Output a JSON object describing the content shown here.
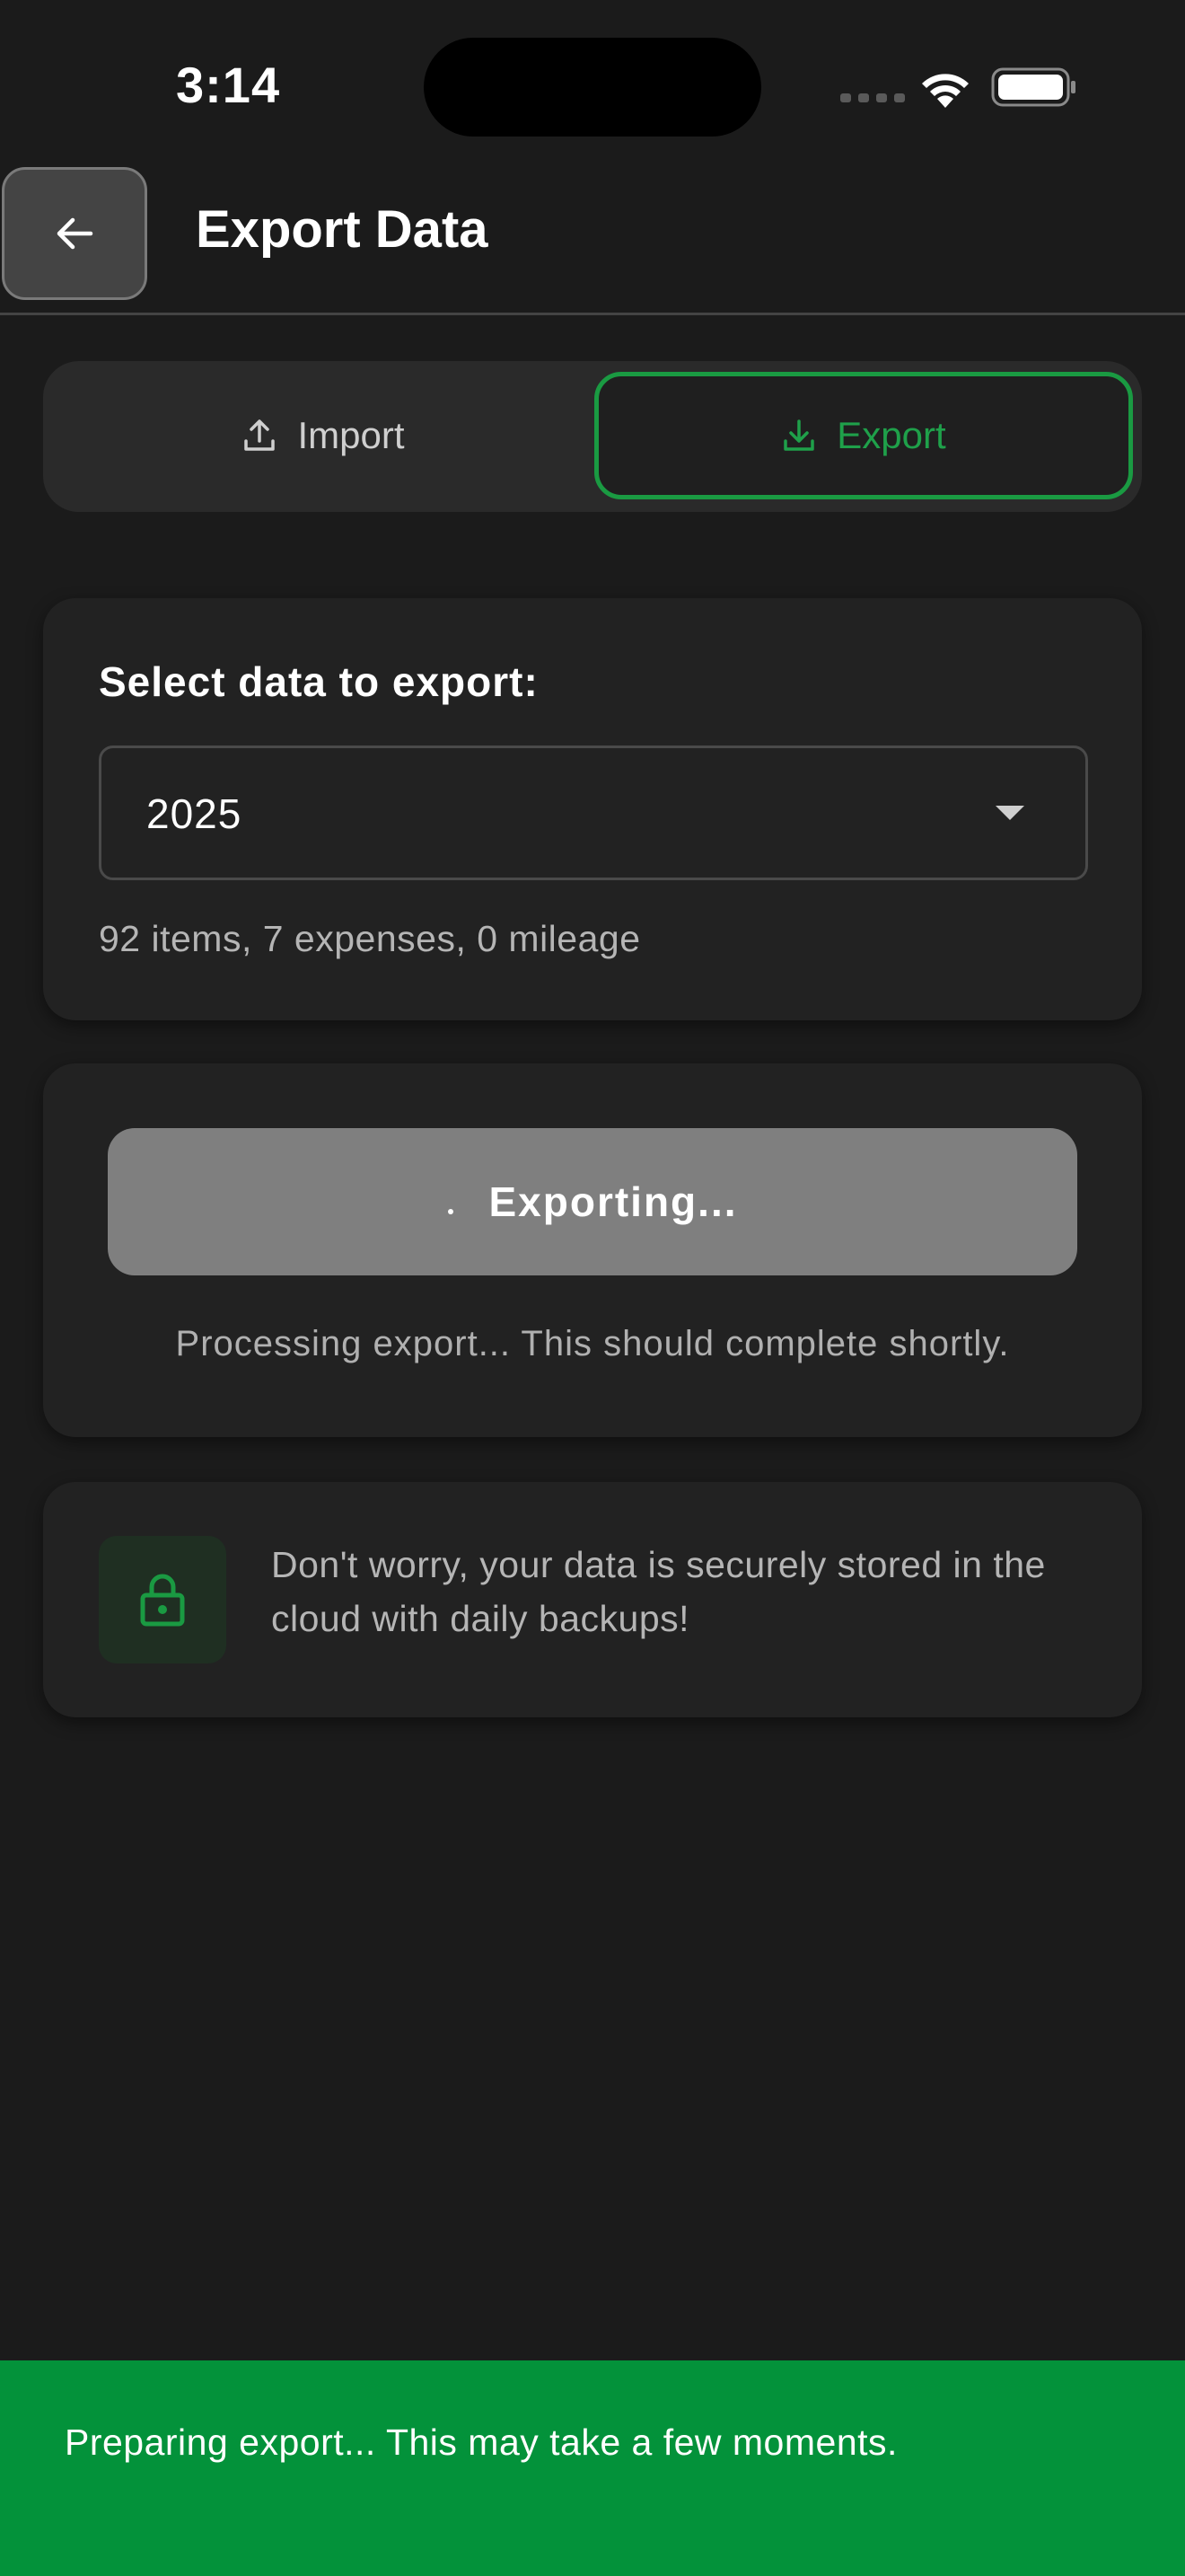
{
  "status_bar": {
    "time": "3:14"
  },
  "header": {
    "title": "Export Data"
  },
  "tabs": [
    {
      "label": "Import",
      "icon": "upload-icon",
      "active": false
    },
    {
      "label": "Export",
      "icon": "download-icon",
      "active": true
    }
  ],
  "export_options": {
    "select_label": "Select data to export:",
    "selected_value": "2025",
    "summary": "92 items, 7 expenses, 0 mileage"
  },
  "progress": {
    "button_label": "Exporting...",
    "message": "Processing export... This should complete shortly."
  },
  "info": {
    "icon": "lock-icon",
    "text": "Don't worry, your data is securely stored in the cloud with daily backups!"
  },
  "toast": {
    "message": "Preparing export... This may take a few moments."
  },
  "colors": {
    "accent": "#1a9a42",
    "background": "#1b1b1b",
    "card": "#222222",
    "toast": "#03923a"
  }
}
